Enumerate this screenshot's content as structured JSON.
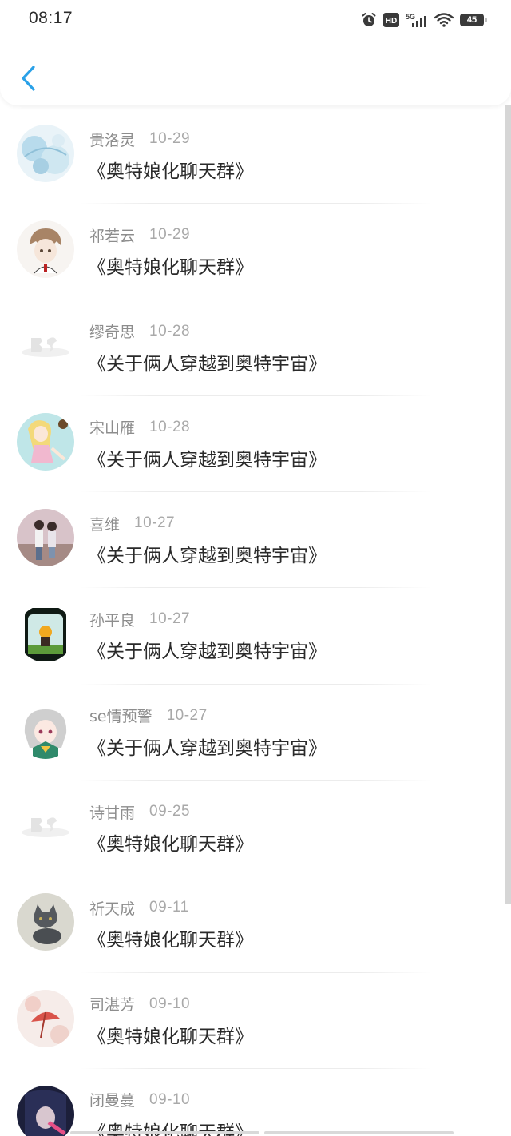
{
  "status_bar": {
    "time": "08:17",
    "battery": "45",
    "network": "5G",
    "hd_label": "HD"
  },
  "header": {
    "back_icon": "chevron-left-icon",
    "accent_color": "#2aa1e8"
  },
  "items": [
    {
      "name": "贵洛灵",
      "date": "10-29",
      "message": "《奥特娘化聊天群》",
      "avatar": "watercolor-blue-avatar"
    },
    {
      "name": "祁若云",
      "date": "10-29",
      "message": "《奥特娘化聊天群》",
      "avatar": "anime-boy-avatar"
    },
    {
      "name": "缪奇思",
      "date": "10-28",
      "message": "《关于俩人穿越到奥特宇宙》",
      "avatar": "faded-logo-avatar"
    },
    {
      "name": "宋山雁",
      "date": "10-28",
      "message": "《关于俩人穿越到奥特宇宙》",
      "avatar": "blonde-girl-avatar"
    },
    {
      "name": "喜维",
      "date": "10-27",
      "message": "《关于俩人穿越到奥特宇宙》",
      "avatar": "couple-avatar"
    },
    {
      "name": "孙平良",
      "date": "10-27",
      "message": "《关于俩人穿越到奥特宇宙》",
      "avatar": "jar-girl-avatar"
    },
    {
      "name": "se情预警",
      "date": "10-27",
      "message": "《关于俩人穿越到奥特宇宙》",
      "avatar": "silver-hair-girl-avatar"
    },
    {
      "name": "诗甘雨",
      "date": "09-25",
      "message": "《奥特娘化聊天群》",
      "avatar": "faded-logo-avatar"
    },
    {
      "name": "祈天成",
      "date": "09-11",
      "message": "《奥特娘化聊天群》",
      "avatar": "grey-kitten-avatar"
    },
    {
      "name": "司湛芳",
      "date": "09-10",
      "message": "《奥特娘化聊天群》",
      "avatar": "red-umbrella-avatar"
    },
    {
      "name": "闭曼蔓",
      "date": "09-10",
      "message": "《奥特娘化聊天群》",
      "avatar": "dark-portrait-avatar"
    }
  ]
}
